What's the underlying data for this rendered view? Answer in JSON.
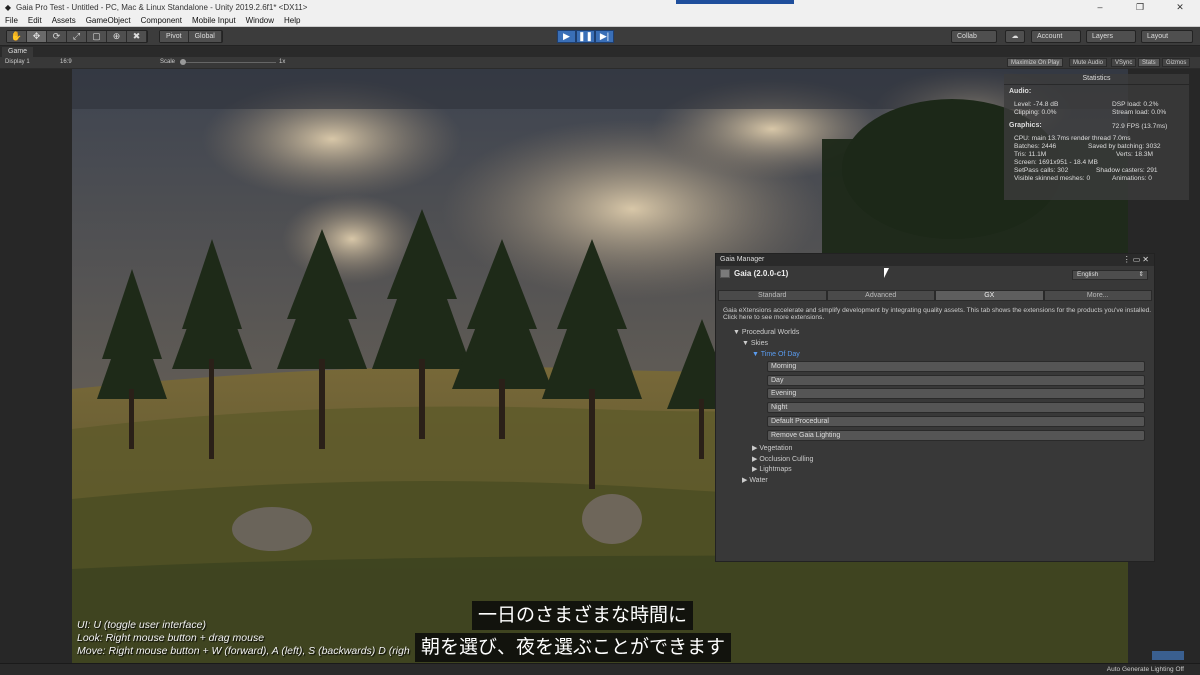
{
  "window": {
    "title": "Gaia Pro Test - Untitled - PC, Mac & Linux Standalone - Unity 2019.2.6f1* <DX11>",
    "controls": [
      "–",
      "❐",
      "✕"
    ]
  },
  "menu": [
    "File",
    "Edit",
    "Assets",
    "GameObject",
    "Component",
    "Mobile Input",
    "Window",
    "Help"
  ],
  "toolbar": {
    "tools": [
      "✋",
      "✥",
      "⟳",
      "⤢",
      "▢",
      "⊕",
      "✖"
    ],
    "pivot": "Pivot",
    "global": "Global",
    "play": [
      "▶",
      "❚❚",
      "▶|"
    ],
    "collab": "Collab",
    "cloud": "☁",
    "account": "Account",
    "layers": "Layers",
    "layout": "Layout"
  },
  "game_tab": {
    "label": "Game",
    "display": "Display 1",
    "aspect": "16:9",
    "scale_label": "Scale",
    "scale_value": "1x",
    "buttons": [
      "Maximize On Play",
      "Mute Audio",
      "VSync",
      "Stats",
      "Gizmos"
    ]
  },
  "stats": {
    "title": "Statistics",
    "audio_heading": "Audio:",
    "level": "Level: -74.8 dB",
    "clipping": "Clipping: 0.0%",
    "dsp_load": "DSP load: 0.2%",
    "stream_load": "Stream load: 0.0%",
    "graphics_heading": "Graphics:",
    "fps": "72.9 FPS (13.7ms)",
    "cpu": "CPU: main 13.7ms  render thread 7.0ms",
    "batches": "Batches: 2446",
    "saved_batching": "Saved by batching: 3032",
    "tris": "Tris: 11.1M",
    "verts": "Verts: 18.3M",
    "screen": "Screen: 1691x951 - 18.4 MB",
    "setpass": "SetPass calls: 302",
    "shadow_casters": "Shadow casters: 291",
    "skinned": "Visible skinned meshes: 0",
    "animations": "Animations: 0"
  },
  "gaia": {
    "window_title": "Gaia Manager",
    "title": "Gaia (2.0.0-c1)",
    "language": "English",
    "tabs": [
      "Standard",
      "Advanced",
      "GX",
      "More..."
    ],
    "description": "Gaia eXtensions accelerate and simplify development by integrating quality assets. This tab shows the extensions for the products you've installed. Click here to see more extensions.",
    "tree": {
      "procedural_worlds": "▼ Procedural Worlds",
      "skies": "▼ Skies",
      "time_of_day": "▼ Time Of Day",
      "vegetation": "▶ Vegetation",
      "occlusion": "▶ Occlusion Culling",
      "lightmaps": "▶ Lightmaps",
      "water": "▶ Water"
    },
    "buttons": [
      "Morning",
      "Day",
      "Evening",
      "Night",
      "Default Procedural",
      "Remove Gaia Lighting"
    ]
  },
  "hints": [
    "UI: U (toggle user interface)",
    "Look: Right mouse button + drag mouse",
    "Move: Right mouse button + W (forward), A (left), S (backwards) D (righ"
  ],
  "subtitles": [
    "一日のさまざまな時間に",
    "朝を選び、夜を選ぶことができます"
  ],
  "status": {
    "right": "Auto Generate Lighting Off"
  }
}
